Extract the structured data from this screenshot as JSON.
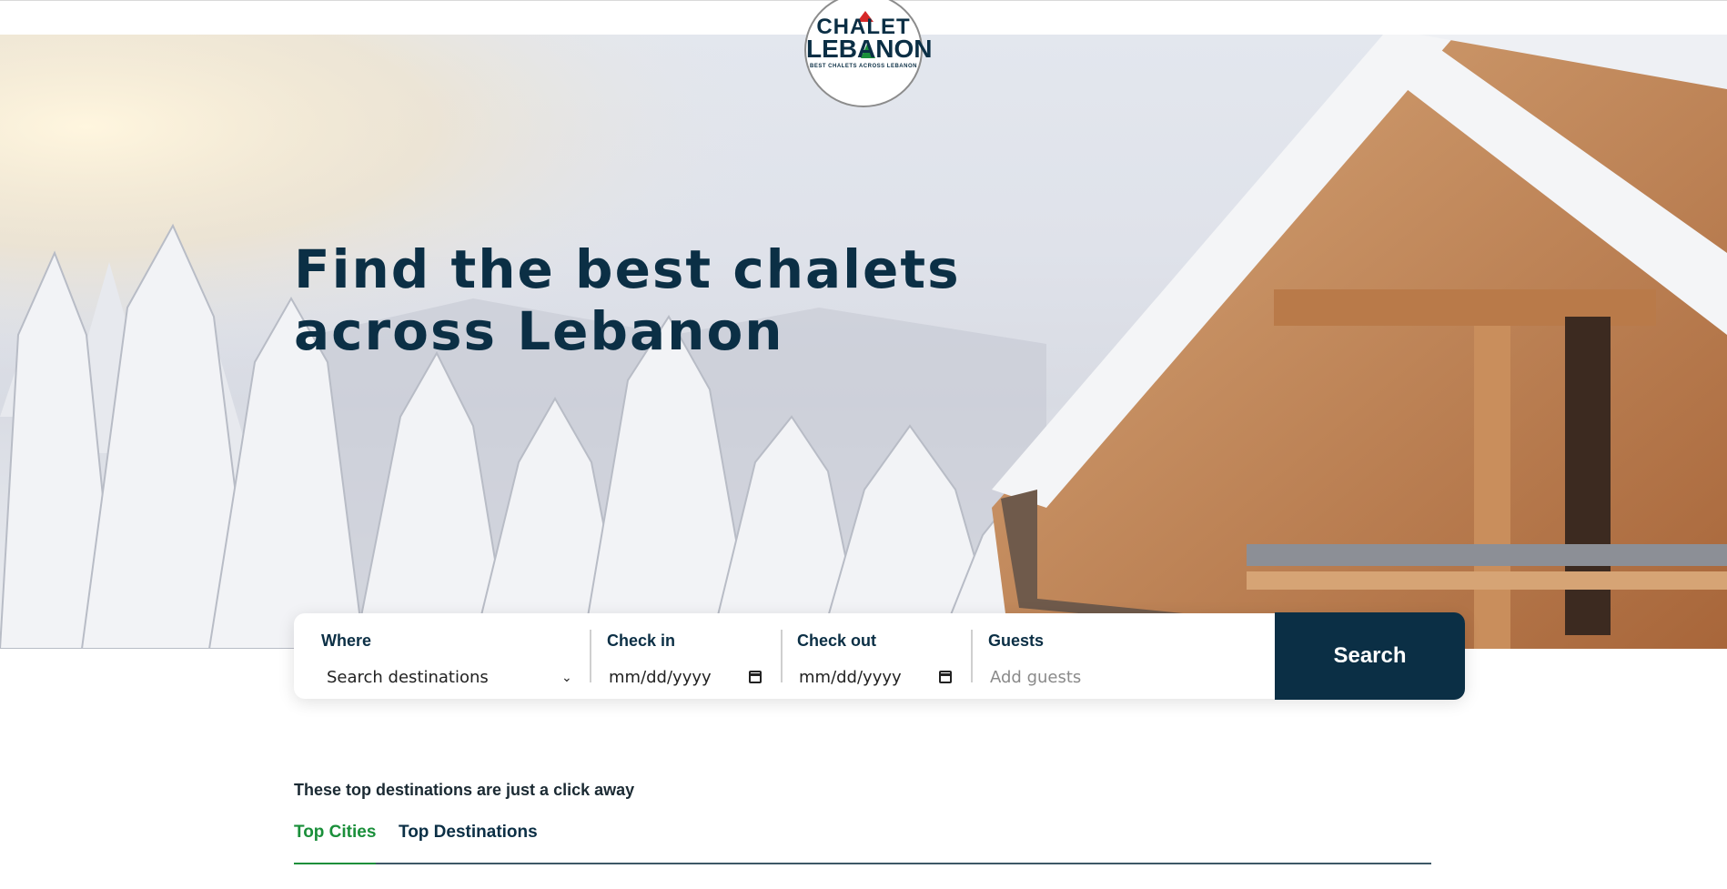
{
  "logo": {
    "line1": "CHALET",
    "line2": "LEBANON",
    "tagline": "BEST CHALETS ACROSS LEBANON"
  },
  "hero": {
    "headline": "Find the best chalets across Lebanon"
  },
  "search": {
    "where_label": "Where",
    "where_value": "Search destinations",
    "checkin_label": "Check in",
    "checkin_value": "mm/dd/yyyy",
    "checkout_label": "Check out",
    "checkout_value": "mm/dd/yyyy",
    "guests_label": "Guests",
    "guests_placeholder": "Add guests",
    "button_label": "Search"
  },
  "destinations": {
    "subheading": "These top destinations are just a click away",
    "tabs": [
      {
        "label": "Top Cities",
        "active": true
      },
      {
        "label": "Top Destinations",
        "active": false
      }
    ]
  },
  "colors": {
    "primary": "#0b2f45",
    "accent": "#1a8f3a"
  }
}
